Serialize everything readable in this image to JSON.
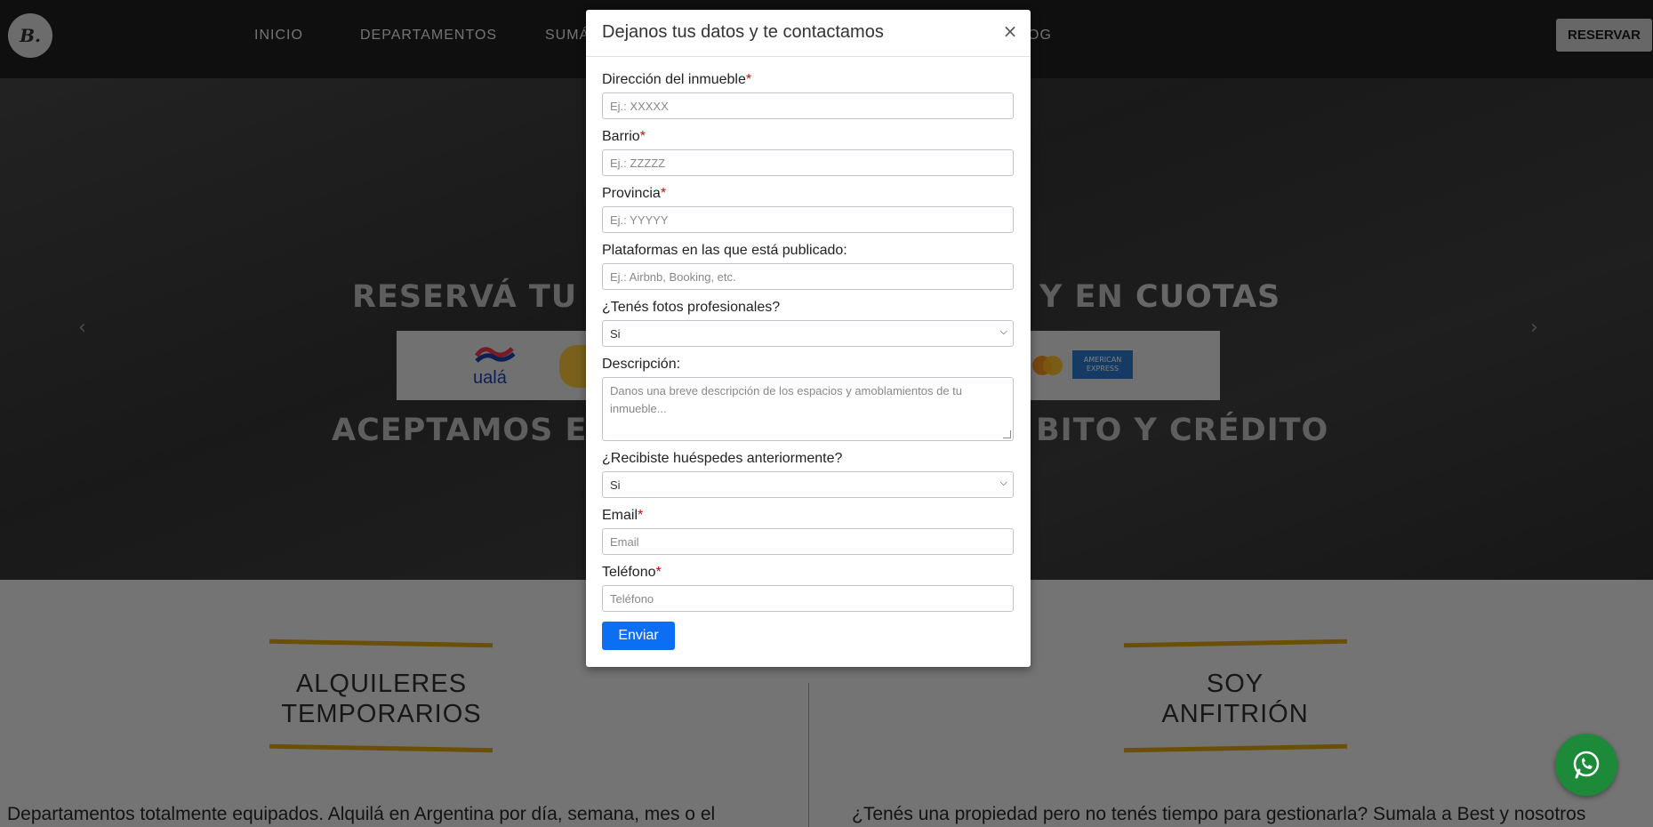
{
  "nav": {
    "logo_text": "B.",
    "links": [
      "INICIO",
      "DEPARTAMENTOS",
      "SUMÁ",
      "OG"
    ],
    "reserve_label": "RESERVAR"
  },
  "hero": {
    "line1_left": "RESERVÁ TU D",
    "line1_right_plain": "Y EN ",
    "line1_right_em": "CUOTAS",
    "line2_left": "ACEPTAMOS EF",
    "line2_right": "BITO Y CRÉDITO",
    "payment_logos": [
      "ualá",
      "MasterCard",
      "AMERICAN EXPRESS"
    ],
    "arrow_prev": "‹",
    "arrow_next": "›"
  },
  "sections": {
    "left_title_1": "ALQUILERES",
    "left_title_2": "TEMPORARIOS",
    "left_text": "Departamentos totalmente equipados. Alquilá en Argentina por día, semana, mes o el",
    "right_title_1": "SOY",
    "right_title_2": "ANFITRIÓN",
    "right_text": "¿Tenés una propiedad pero no tenés tiempo para gestionarla? Sumala a Best y nosotros"
  },
  "modal": {
    "title": "Dejanos tus datos y te contactamos",
    "close_glyph": "×",
    "fields": {
      "address_label": "Dirección del inmueble",
      "address_placeholder": "Ej.: XXXXX",
      "neighborhood_label": "Barrio",
      "neighborhood_placeholder": "Ej.: ZZZZZ",
      "province_label": "Provincia",
      "province_placeholder": "Ej.: YYYYY",
      "platforms_label": "Plataformas en las que está publicado:",
      "platforms_placeholder": "Ej.: Airbnb, Booking, etc.",
      "photos_label": "¿Tenés fotos profesionales?",
      "photos_value": "Si",
      "description_label": "Descripción:",
      "description_placeholder": "Danos una breve descripción de los espacios y amoblamientos de tu inmueble...",
      "guests_label": "¿Recibiste huéspedes anteriormente?",
      "guests_value": "Si",
      "email_label": "Email",
      "email_placeholder": "Email",
      "phone_label": "Teléfono",
      "phone_placeholder": "Teléfono"
    },
    "required_mark": "*",
    "submit_label": "Enviar"
  },
  "colors": {
    "nav_bg": "#1e1e1e",
    "accent_gold": "#d4a10e",
    "submit_blue": "#0b6ef3",
    "whatsapp_green": "#1d8a3a",
    "required_red": "#e00000"
  }
}
